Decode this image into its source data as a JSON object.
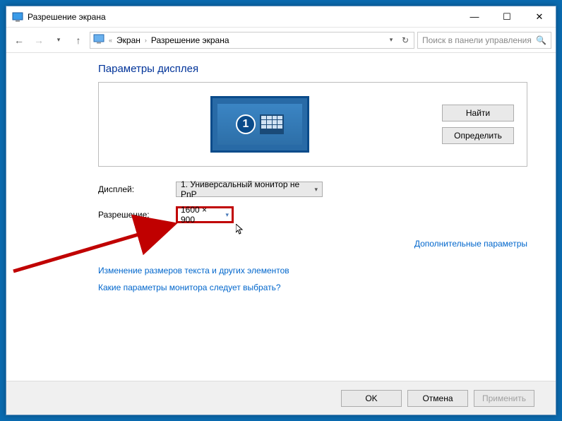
{
  "window": {
    "title": "Разрешение экрана",
    "minimize": "—",
    "maximize": "☐",
    "close": "✕"
  },
  "nav": {
    "back": "←",
    "forward": "→",
    "up": "↑",
    "crumb1": "Экран",
    "crumb2": "Разрешение экрана",
    "search_placeholder": "Поиск в панели управления"
  },
  "content": {
    "heading": "Параметры дисплея",
    "monitor_number": "1",
    "find_btn": "Найти",
    "detect_btn": "Определить",
    "display_label": "Дисплей:",
    "display_value": "1. Универсальный монитор не PnP",
    "resolution_label": "Разрешение:",
    "resolution_value": "1600 × 900",
    "advanced_link": "Дополнительные параметры",
    "link1": "Изменение размеров текста и других элементов",
    "link2": "Какие параметры монитора следует выбрать?"
  },
  "buttons": {
    "ok": "OK",
    "cancel": "Отмена",
    "apply": "Применить"
  }
}
